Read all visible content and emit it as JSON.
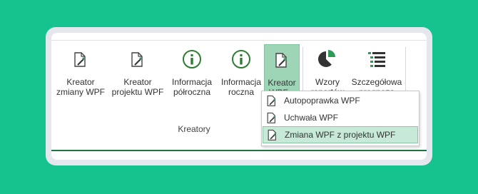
{
  "ribbon": {
    "group_label": "Kreatory",
    "buttons": [
      {
        "line1": "Kreator",
        "line2": "zmiany WPF",
        "icon": "wizard-page-icon"
      },
      {
        "line1": "Kreator",
        "line2": "projektu WPF",
        "icon": "wizard-page-icon"
      },
      {
        "line1": "Informacja",
        "line2": "półroczna",
        "icon": "info-icon"
      },
      {
        "line1": "Informacja",
        "line2": "roczna",
        "icon": "info-icon"
      },
      {
        "line1": "Kreator",
        "line2": "WPF",
        "icon": "wizard-page-icon"
      },
      {
        "line1": "Wzory",
        "line2": "raportów",
        "icon": "pie-chart-icon"
      },
      {
        "line1": "Szczegółowa",
        "line2": "prognoza",
        "icon": "list-detail-icon"
      }
    ]
  },
  "dropdown": {
    "items": [
      {
        "label": "Autopoprawka WPF",
        "icon": "wizard-page-icon"
      },
      {
        "label": "Uchwała WPF",
        "icon": "wizard-page-icon"
      },
      {
        "label": "Zmiana WPF z projektu WPF",
        "icon": "wizard-page-icon"
      }
    ]
  },
  "colors": {
    "background": "#14c38e",
    "accent_green": "#217346",
    "active_button": "#9fd5b7",
    "hover_item": "#c6ead7"
  }
}
